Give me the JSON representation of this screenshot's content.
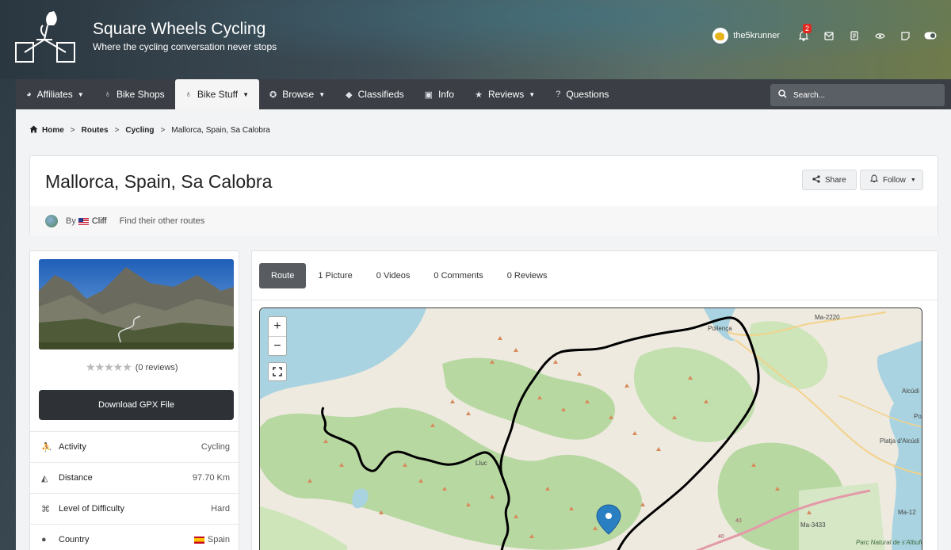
{
  "site": {
    "title": "Square Wheels Cycling",
    "tagline": "Where the cycling conversation never stops"
  },
  "user": {
    "name": "the5krunner",
    "alerts_count": "2"
  },
  "nav": {
    "items": [
      {
        "label": "Affiliates",
        "icon": "bullhorn-icon",
        "glyph": "◕",
        "dropdown": true
      },
      {
        "label": "Bike Shops",
        "icon": "bicycle-icon",
        "glyph": "♁",
        "dropdown": false
      },
      {
        "label": "Bike Stuff",
        "icon": "bicycle-icon",
        "glyph": "♁",
        "dropdown": true,
        "active": true
      },
      {
        "label": "Browse",
        "icon": "compass-icon",
        "glyph": "✪",
        "dropdown": true
      },
      {
        "label": "Classifieds",
        "icon": "tag-icon",
        "glyph": "◆",
        "dropdown": false
      },
      {
        "label": "Info",
        "icon": "info-icon",
        "glyph": "▣",
        "dropdown": false
      },
      {
        "label": "Reviews",
        "icon": "star-icon",
        "glyph": "★",
        "dropdown": true
      },
      {
        "label": "Questions",
        "icon": "question-icon",
        "glyph": "?",
        "dropdown": false
      }
    ],
    "search_placeholder": "Search..."
  },
  "breadcrumb": [
    "Home",
    "Routes",
    "Cycling",
    "Mallorca, Spain, Sa Calobra"
  ],
  "route": {
    "title": "Mallorca, Spain, Sa Calobra",
    "by_label": "By",
    "author": "Cliff",
    "other_routes_link": "Find their other routes",
    "share_label": "Share",
    "follow_label": "Follow"
  },
  "sidebar": {
    "rating_text": "(0 reviews)",
    "rating_value": 0,
    "download_label": "Download GPX File",
    "specs": [
      {
        "label": "Activity",
        "value": "Cycling",
        "icon": "activity-icon",
        "glyph": "⛹"
      },
      {
        "label": "Distance",
        "value": "97.70 Km",
        "icon": "road-icon",
        "glyph": "◭"
      },
      {
        "label": "Level of Difficulty",
        "value": "Hard",
        "icon": "difficulty-icon",
        "glyph": "⌘"
      },
      {
        "label": "Country",
        "value": "Spain",
        "icon": "location-icon",
        "glyph": "●"
      }
    ]
  },
  "tabs": [
    "Route",
    "1 Picture",
    "0 Videos",
    "0 Comments",
    "0 Reviews"
  ],
  "map": {
    "labels": [
      "Pollença",
      "Ma-2220",
      "Alcúdi",
      "Po",
      "Platja d'Alcúdi",
      "Lluc",
      "Ma-12",
      "Ma-3433",
      "Parc Natural de s'Albufera",
      "40",
      "40"
    ],
    "zoom_in": "+",
    "zoom_out": "−"
  },
  "colors": {
    "nav_bg": "#3b3f45",
    "download_btn": "#2e3237",
    "active_tab": "#585c61",
    "route_line": "#000000",
    "map_marker": "#2a7ec2",
    "alert_badge": "#e0281f"
  }
}
